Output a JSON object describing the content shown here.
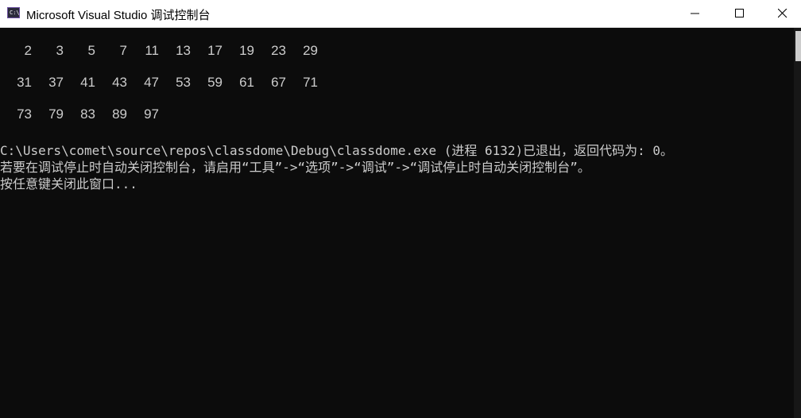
{
  "window": {
    "title": "Microsoft Visual Studio 调试控制台",
    "icon": "console-app-icon",
    "icon_text": "C:\\"
  },
  "controls": {
    "minimize": "minimize-icon",
    "maximize": "maximize-icon",
    "close": "close-icon"
  },
  "console": {
    "rows": [
      [
        "2",
        "3",
        "5",
        "7",
        "11",
        "13",
        "17",
        "19",
        "23",
        "29"
      ],
      [
        "31",
        "37",
        "41",
        "43",
        "47",
        "53",
        "59",
        "61",
        "67",
        "71"
      ],
      [
        "73",
        "79",
        "83",
        "89",
        "97"
      ]
    ],
    "exit_line": "C:\\Users\\comet\\source\\repos\\classdome\\Debug\\classdome.exe (进程 6132)已退出，返回代码为: 0。",
    "hint_line": "若要在调试停止时自动关闭控制台，请启用“工具”->“选项”->“调试”->“调试停止时自动关闭控制台”。",
    "press_key_line": "按任意键关闭此窗口..."
  },
  "colors": {
    "background": "#0c0c0c",
    "text": "#cccccc",
    "titlebar": "#ffffff"
  }
}
